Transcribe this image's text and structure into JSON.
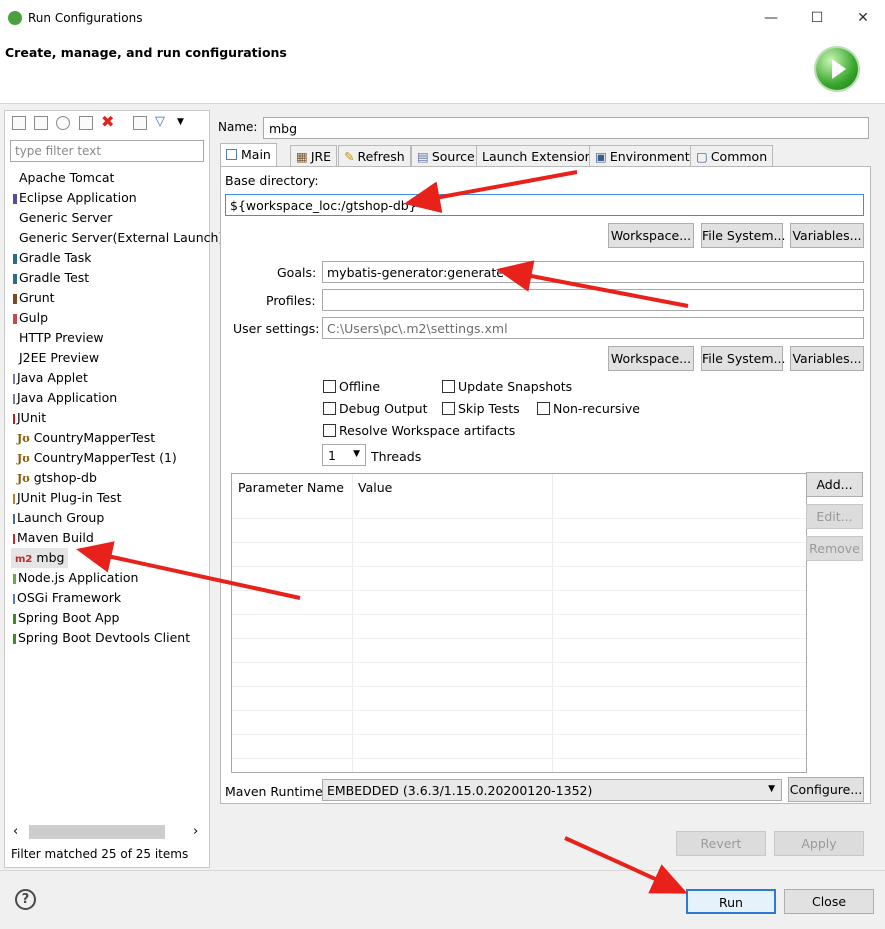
{
  "window": {
    "title": "Run Configurations",
    "minimize": "—",
    "maximize": "☐",
    "close": "✕"
  },
  "header": {
    "title": "Create, manage, and run configurations"
  },
  "left": {
    "filter_placeholder": "type filter text",
    "items": [
      "Apache Tomcat",
      "Eclipse Application",
      "Generic Server",
      "Generic Server(External Launch)",
      "Gradle Task",
      "Gradle Test",
      "Grunt",
      "Gulp",
      "HTTP Preview",
      "J2EE Preview",
      "Java Applet",
      "Java Application",
      "JUnit",
      "CountryMapperTest",
      "CountryMapperTest (1)",
      "gtshop-db",
      "JUnit Plug-in Test",
      "Launch Group",
      "Maven Build",
      "mbg",
      "Node.js Application",
      "OSGi Framework",
      "Spring Boot App",
      "Spring Boot Devtools Client"
    ],
    "ju_badge": "Jʊ",
    "m2_badge": "m2",
    "status": "Filter matched 25 of 25 items",
    "scroll_left": "‹",
    "scroll_right": "›"
  },
  "config": {
    "name_label": "Name:",
    "name_value": "mbg",
    "tabs": [
      "Main",
      "JRE",
      "Refresh",
      "Source",
      "Launch Extensions",
      "Environment",
      "Common"
    ],
    "base_dir_label": "Base directory:",
    "base_dir_value": "${workspace_loc:/gtshop-db}",
    "workspace_btn": "Workspace...",
    "filesystem_btn": "File System...",
    "variables_btn": "Variables...",
    "goals_label": "Goals:",
    "goals_value": "mybatis-generator:generate",
    "profiles_label": "Profiles:",
    "profiles_value": "",
    "user_settings_label": "User settings:",
    "user_settings_value": "C:\\Users\\pc\\.m2\\settings.xml",
    "checkboxes": {
      "offline": "Offline",
      "update_snapshots": "Update Snapshots",
      "debug_output": "Debug Output",
      "skip_tests": "Skip Tests",
      "non_recursive": "Non-recursive",
      "resolve_workspace": "Resolve Workspace artifacts"
    },
    "threads_value": "1",
    "threads_label": "Threads",
    "param_headers": [
      "Parameter Name",
      "Value"
    ],
    "add_btn": "Add...",
    "edit_btn": "Edit...",
    "remove_btn": "Remove",
    "runtime_label": "Maven Runtime:",
    "runtime_value": "EMBEDDED (3.6.3/1.15.0.20200120-1352)",
    "configure_btn": "Configure...",
    "revert_btn": "Revert",
    "apply_btn": "Apply"
  },
  "footer": {
    "help": "?",
    "run_btn": "Run",
    "close_btn": "Close"
  },
  "colors": {
    "arrow": "#e8221b",
    "accent": "#2a7ad6"
  }
}
